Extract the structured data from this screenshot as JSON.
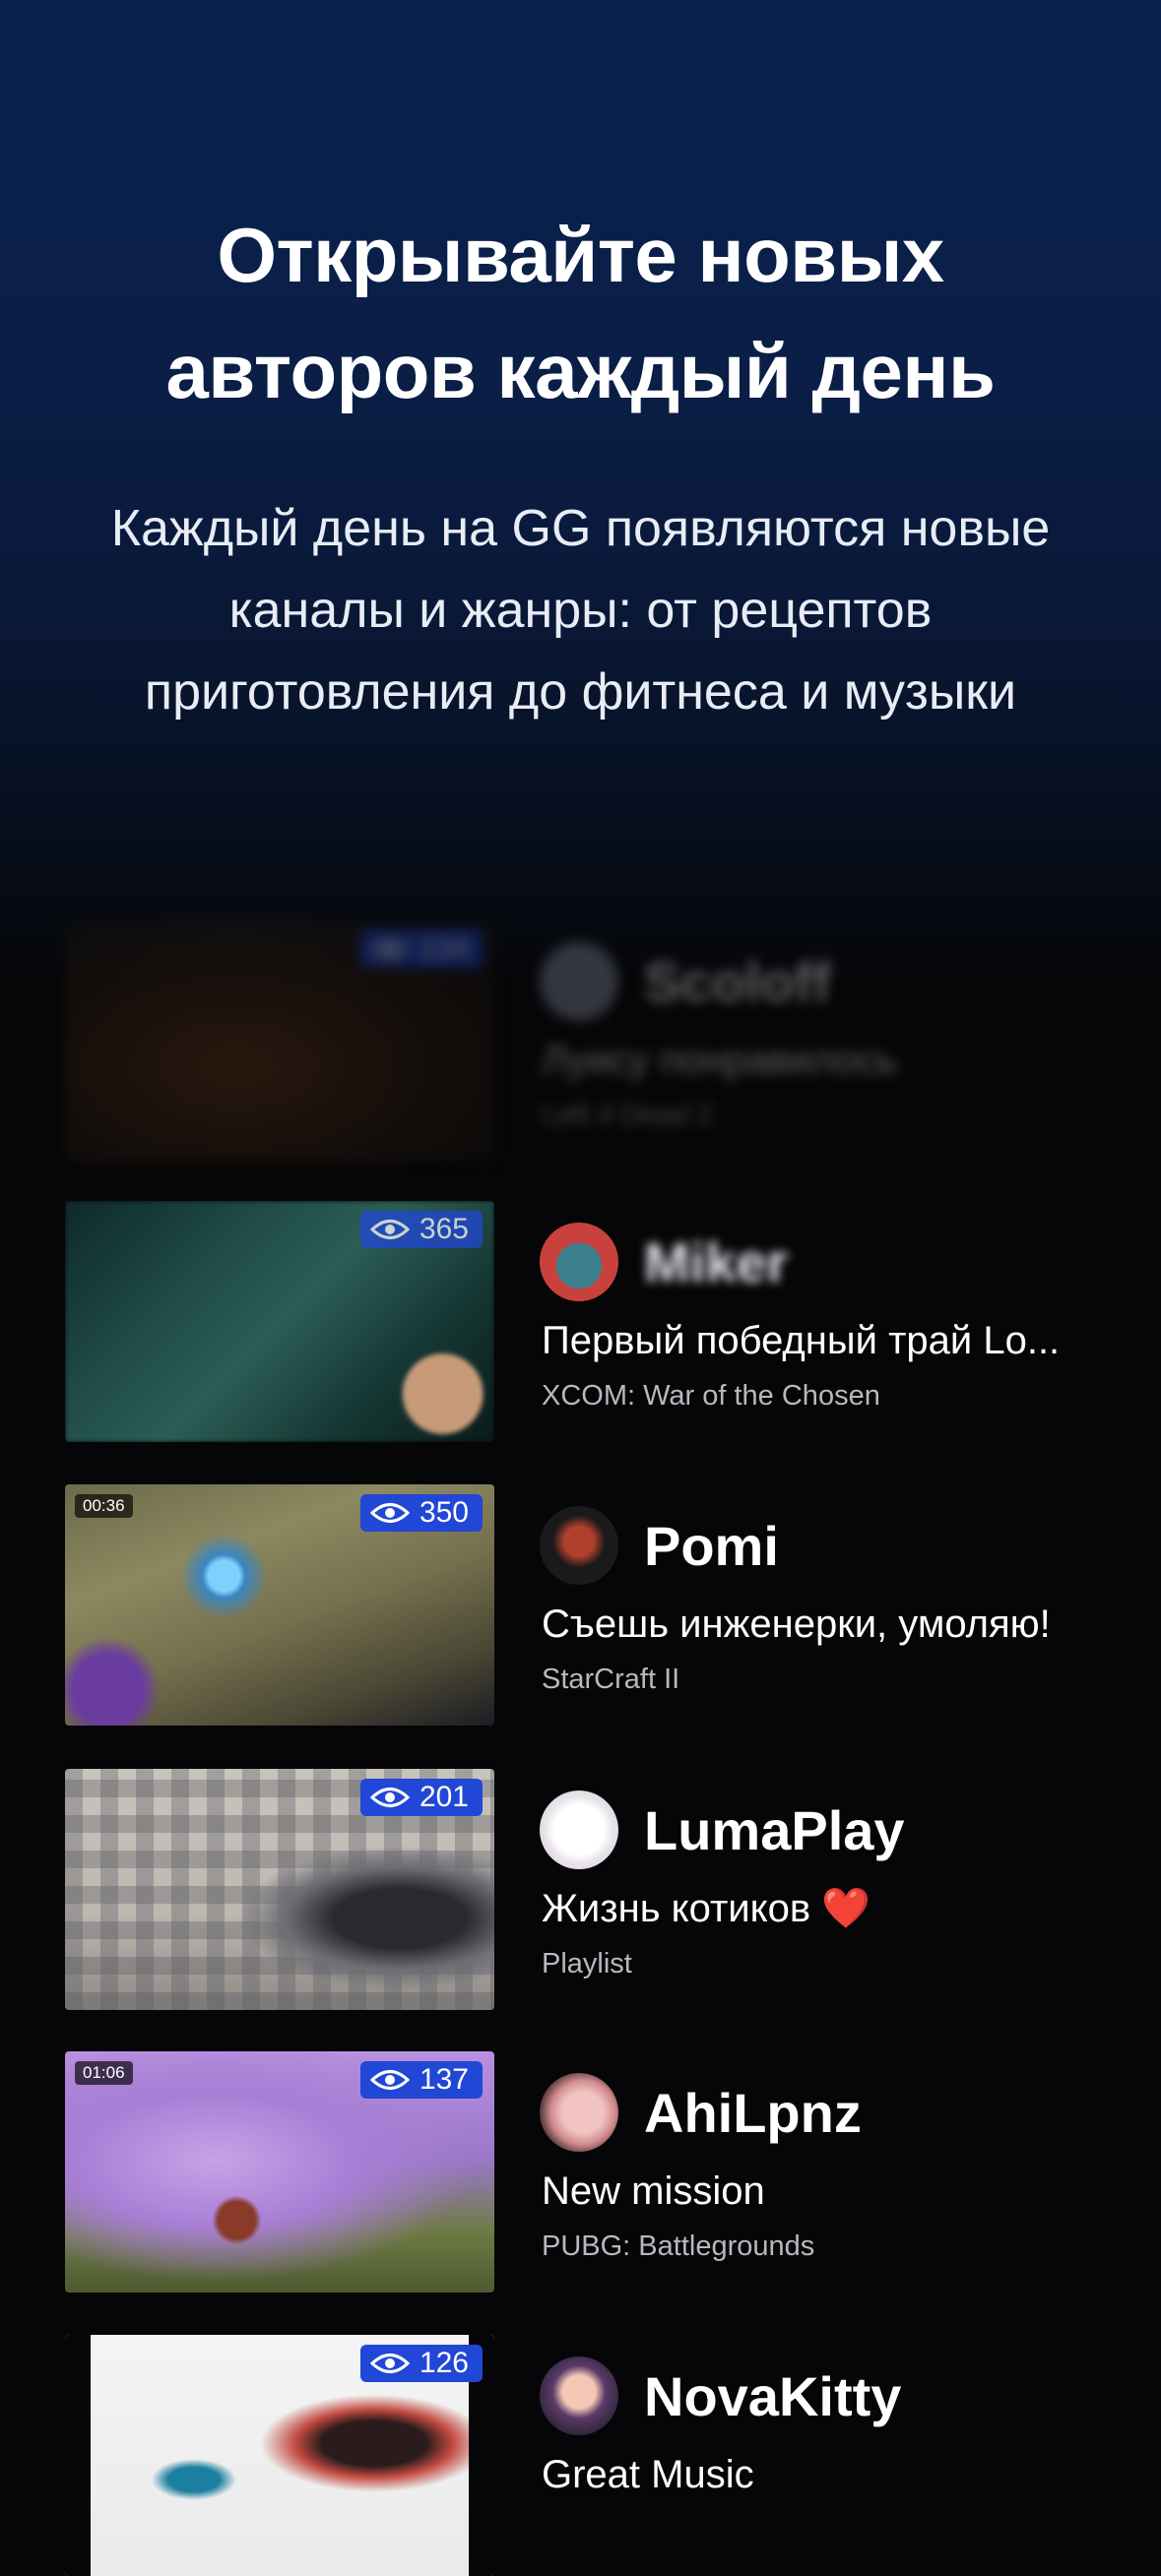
{
  "hero": {
    "title_line1": "Открывайте новых",
    "title_line2": "авторов каждый день",
    "subtitle_line1": "Каждый день на GG появляются новые",
    "subtitle_line2": "каналы и жанры: от рецептов",
    "subtitle_line3": "приготовления до фитнеса и музыки"
  },
  "colors": {
    "hero_top": "#08224d",
    "background": "#060608",
    "views_badge": "#2147d6"
  },
  "streams": [
    {
      "author": "Scoloff",
      "title": "Луису понравилось",
      "game": "Left 4 Dead 2",
      "views": "134",
      "duration": "",
      "blurred": true
    },
    {
      "author": "Miker",
      "title": "Первый победный трай Lo...",
      "game": "XCOM: War of the Chosen",
      "views": "365",
      "duration": ""
    },
    {
      "author": "Pomi",
      "title": "Съешь инженерки, умоляю!",
      "game": "StarCraft II",
      "views": "350",
      "duration": "00:36"
    },
    {
      "author": "LumaPlay",
      "title": "Жизнь котиков ❤️",
      "game": "Playlist",
      "views": "201",
      "duration": ""
    },
    {
      "author": "AhiLpnz",
      "title": "New mission",
      "game": "PUBG: Battlegrounds",
      "views": "137",
      "duration": "01:06"
    },
    {
      "author": "NovaKitty",
      "title": "Great Music",
      "game": "",
      "views": "126",
      "duration": ""
    }
  ],
  "icons": {
    "views": "eye-icon"
  }
}
